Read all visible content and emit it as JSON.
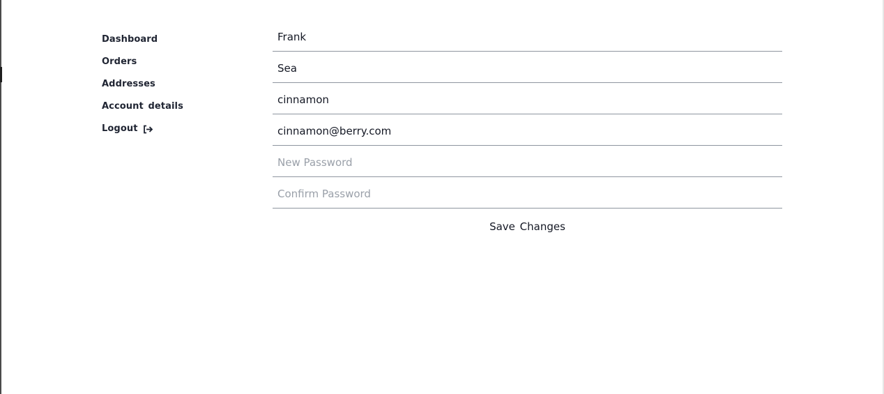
{
  "sidebar": {
    "items": [
      {
        "label": "Dashboard"
      },
      {
        "label": "Orders"
      },
      {
        "label": "Addresses"
      },
      {
        "label": "Account details"
      },
      {
        "label": "Logout",
        "icon": "logout-icon"
      }
    ]
  },
  "form": {
    "first_name": {
      "value": "Frank",
      "placeholder": ""
    },
    "last_name": {
      "value": "Sea",
      "placeholder": ""
    },
    "username": {
      "value": "cinnamon",
      "placeholder": ""
    },
    "email": {
      "value": "cinnamon@berry.com",
      "placeholder": ""
    },
    "new_password": {
      "value": "",
      "placeholder": "New Password"
    },
    "confirm_password": {
      "value": "",
      "placeholder": "Confirm Password"
    },
    "save_label": "Save Changes"
  },
  "colors": {
    "text": "#1f2432",
    "placeholder": "#9aa0a9",
    "underline": "#8e959f",
    "background": "#ffffff"
  }
}
